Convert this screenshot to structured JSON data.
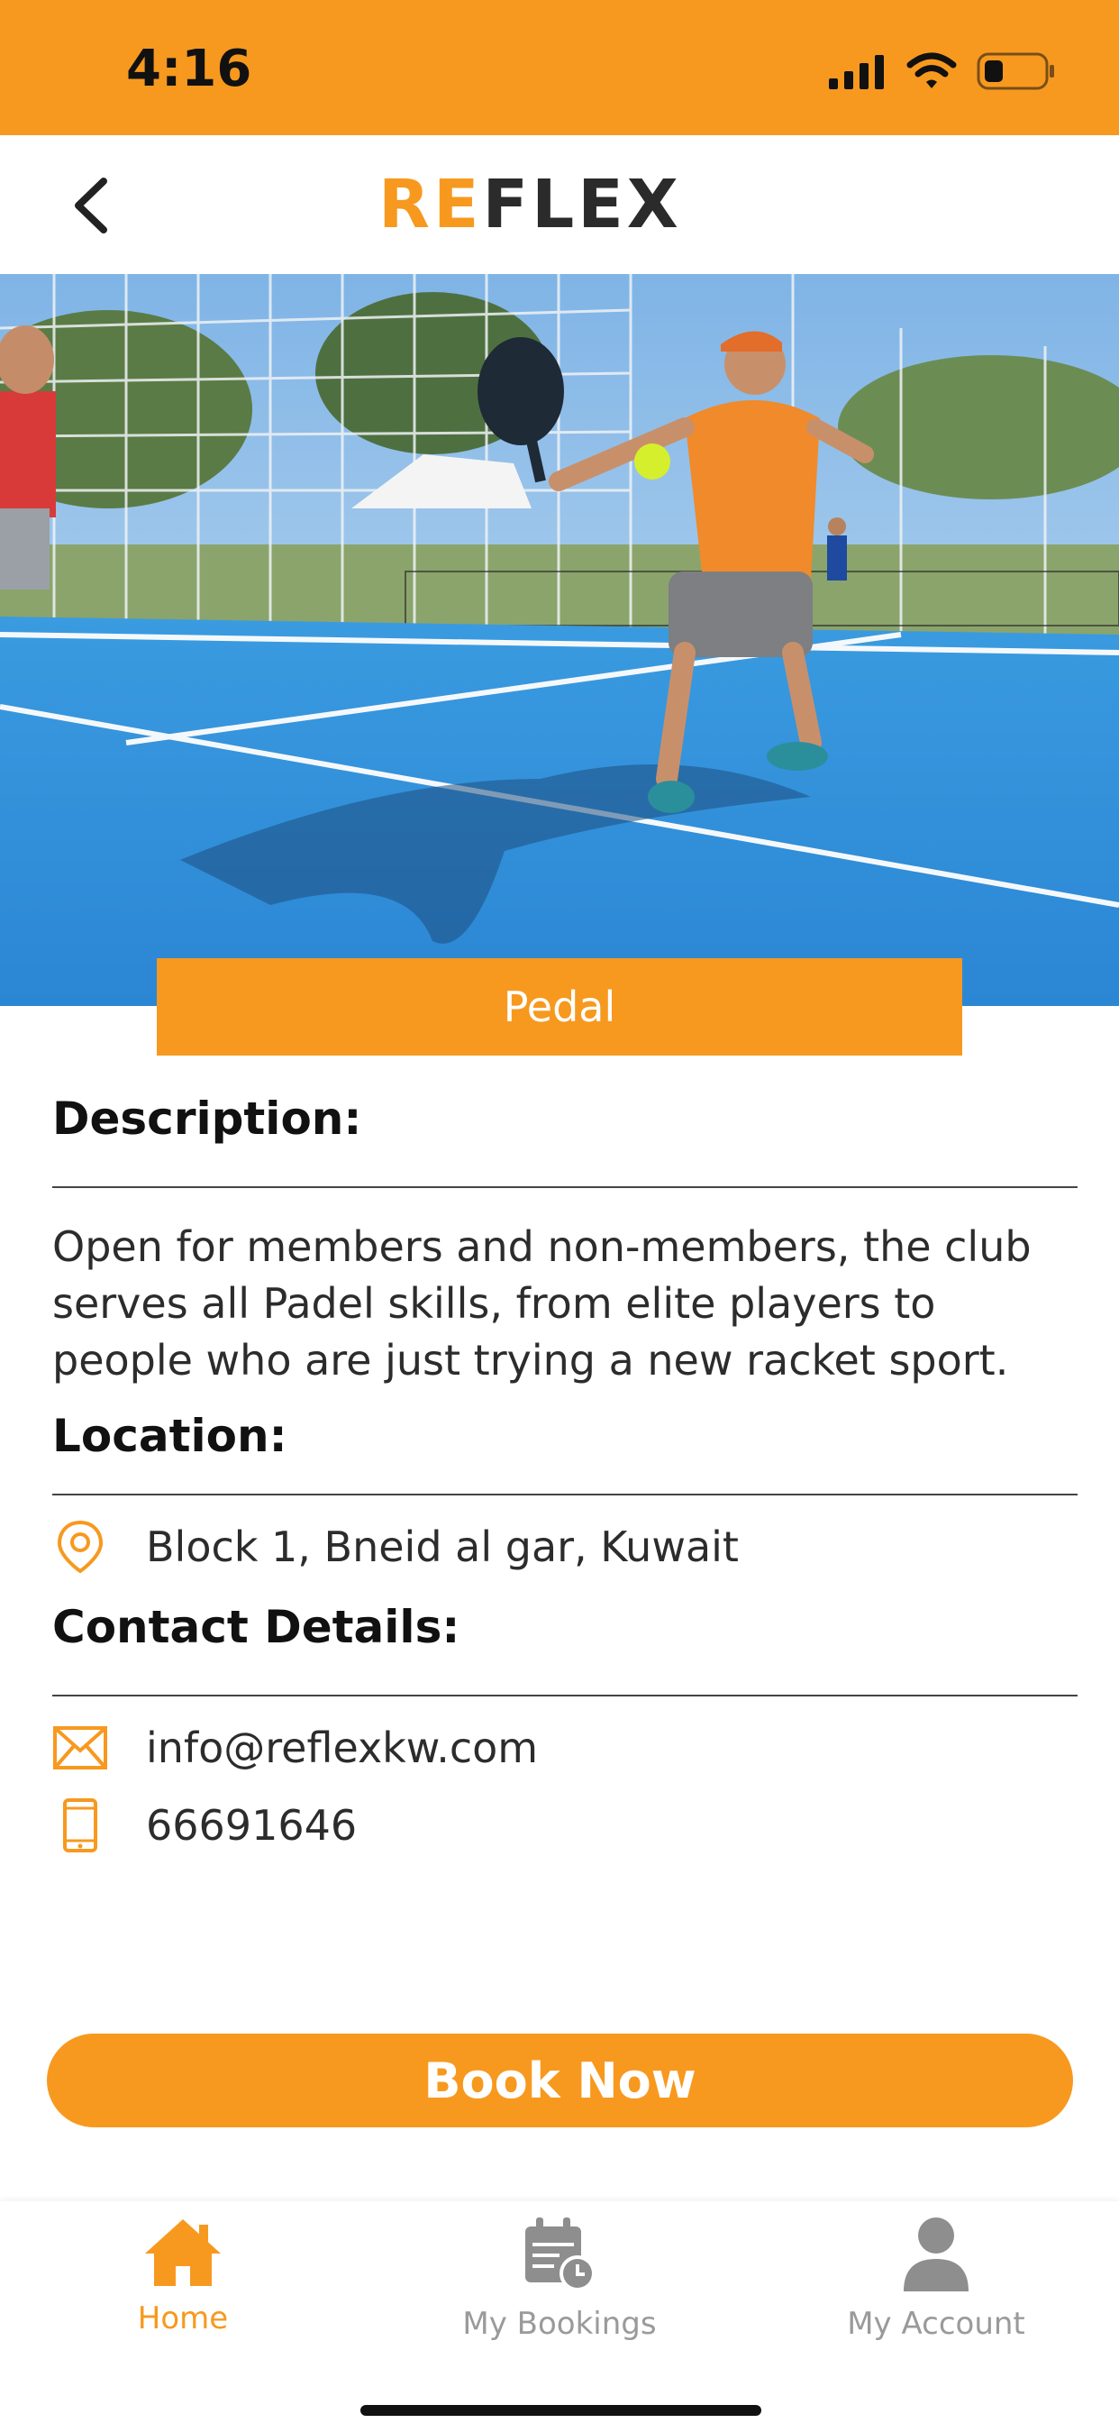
{
  "status": {
    "time": "4:16"
  },
  "header": {
    "logo_text": "REFLEX",
    "logo_orange": "#f7991f",
    "logo_dark": "#2b2b2b"
  },
  "sport": {
    "name": "Pedal"
  },
  "description": {
    "title": "Description:",
    "text": "Open for members and non-members, the club serves all Padel skills, from elite players to people who are just trying a new racket sport."
  },
  "location": {
    "title": "Location:",
    "address": "Block 1, Bneid al gar, Kuwait",
    "icon": "location-pin-icon"
  },
  "contact": {
    "title": "Contact Details:",
    "email": "info@reflexkw.com",
    "phone": "66691646",
    "email_icon": "envelope-icon",
    "phone_icon": "mobile-phone-icon"
  },
  "book_label": "Book Now",
  "tabs": [
    {
      "label": "Home",
      "icon": "home-icon",
      "active": true
    },
    {
      "label": "My Bookings",
      "icon": "calendar-clock-icon",
      "active": false
    },
    {
      "label": "My Account",
      "icon": "user-icon",
      "active": false
    }
  ],
  "colors": {
    "accent": "#f7991f",
    "inactive": "#9a9a9a",
    "text": "#2c2c2c"
  }
}
